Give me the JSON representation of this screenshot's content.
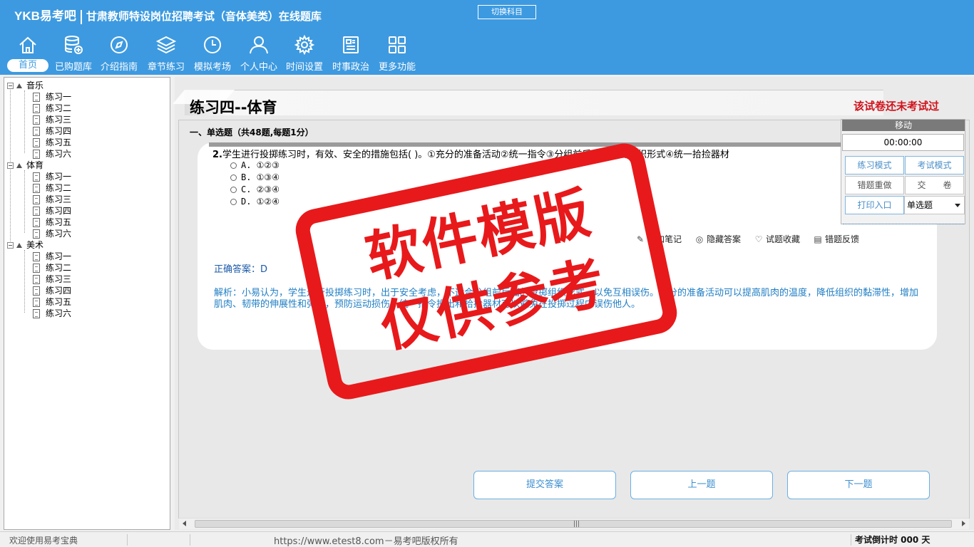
{
  "app": {
    "logo": "YKB易考吧",
    "subtitle": "甘肃教师特设岗位招聘考试（音体美类）在线题库",
    "switch_subject": "切换科目"
  },
  "nav": [
    {
      "label": "首页",
      "icon": "home-icon",
      "active": true
    },
    {
      "label": "已购题库",
      "icon": "database-icon"
    },
    {
      "label": "介绍指南",
      "icon": "compass-icon"
    },
    {
      "label": "章节练习",
      "icon": "layers-icon"
    },
    {
      "label": "模拟考场",
      "icon": "clock-icon"
    },
    {
      "label": "个人中心",
      "icon": "user-icon"
    },
    {
      "label": "时间设置",
      "icon": "gear-icon"
    },
    {
      "label": "时事政治",
      "icon": "news-icon"
    },
    {
      "label": "更多功能",
      "icon": "grid-icon"
    }
  ],
  "tree": [
    {
      "label": "音乐",
      "items": [
        "练习一",
        "练习二",
        "练习三",
        "练习四",
        "练习五",
        "练习六"
      ]
    },
    {
      "label": "体育",
      "items": [
        "练习一",
        "练习二",
        "练习三",
        "练习四",
        "练习五",
        "练习六"
      ]
    },
    {
      "label": "美术",
      "items": [
        "练习一",
        "练习二",
        "练习三",
        "练习四",
        "练习五",
        "练习六"
      ]
    }
  ],
  "page": {
    "title": "练习四--体育",
    "exam_status": "该试卷还未考试过",
    "section_title": "一、单选题（共48题,每题1分）"
  },
  "question": {
    "number": "2.",
    "text": "学生进行投掷练习时，有效、安全的措施包括( )。①充分的准备活动②统一指令③分组前后面的投掷组织形式④统一拾捡器材",
    "options": [
      "A. ①②③",
      "B. ①③④",
      "C. ②③④",
      "D. ①②④"
    ],
    "answer": "正确答案：D",
    "analysis": "解析：小易认为，学生进行投掷练习时，出于安全考虑，不适合分组前后面的投掷组织形式，以免互相误伤。充分的准备活动可以提高肌肉的温度，降低组织的黏滞性，增加肌肉、韧带的伸展性和弹性，预防运动损伤；统一指令投出和拾捡器材可以避免在投掷过程中误伤他人。"
  },
  "tools": {
    "add_note": "添加笔记",
    "hide_answer": "隐藏答案",
    "favorite": "试题收藏",
    "feedback": "错题反馈"
  },
  "right_panel": {
    "header": "移动",
    "timer": "00:00:00",
    "practice_mode": "练习模式",
    "exam_mode": "考试模式",
    "redo_wrong": "错题重做",
    "submit_paper": "交　　卷",
    "print_entry": "打印入口",
    "type_select": "单选题"
  },
  "buttons": {
    "submit": "提交答案",
    "prev": "上一题",
    "next": "下一题"
  },
  "status_bar": {
    "welcome": "欢迎使用易考宝典",
    "copyright": "https://www.etest8.com－易考吧版权所有",
    "countdown": "考试倒计时 000 天"
  },
  "watermark": {
    "line1": "软件模版",
    "line2": "仅供参考"
  },
  "colors": {
    "header_blue": "#3d9ae0",
    "status_red": "#d0121b",
    "stamp_red": "#e8191b",
    "analysis_blue": "#1f7ec4"
  }
}
